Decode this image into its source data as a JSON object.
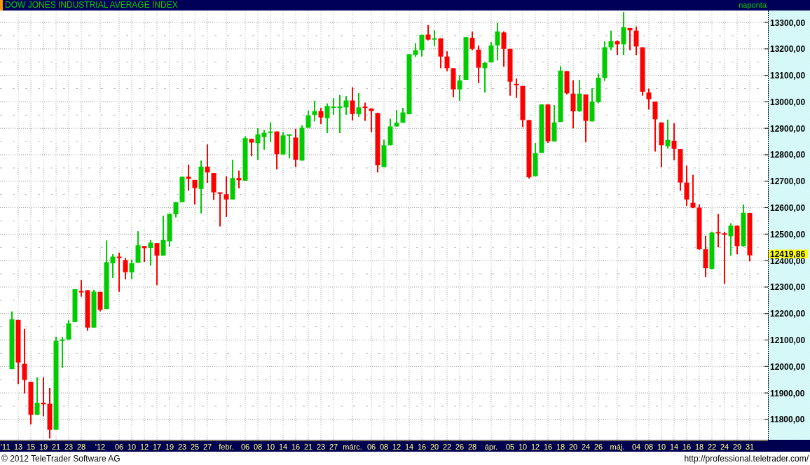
{
  "header": {
    "title": "DOW JONES INDUSTRIAL AVERAGE INDEX",
    "interval": "naponta"
  },
  "chart": {
    "start_year": "'11",
    "last_price": "12419,86",
    "chart_data": {
      "type": "candlestick",
      "grid": true,
      "ylim": [
        11723,
        13345
      ],
      "categories": [
        null,
        "13",
        null,
        "15",
        null,
        "19",
        null,
        "21",
        null,
        "23",
        null,
        "28",
        null,
        null,
        "'12",
        null,
        null,
        "06",
        null,
        "10",
        null,
        "12",
        null,
        "17",
        null,
        "19",
        null,
        "23",
        null,
        "25",
        null,
        "27",
        null,
        null,
        "febr.",
        null,
        null,
        "06",
        null,
        "08",
        null,
        "10",
        null,
        "14",
        null,
        "16",
        null,
        "21",
        null,
        "23",
        null,
        "27",
        null,
        null,
        "márc.",
        null,
        null,
        "06",
        null,
        "08",
        null,
        "12",
        null,
        "14",
        null,
        "16",
        null,
        "20",
        null,
        "22",
        null,
        "26",
        null,
        "28",
        null,
        null,
        "ápr.",
        null,
        null,
        "05",
        null,
        "10",
        null,
        "12",
        null,
        "16",
        null,
        "18",
        null,
        "20",
        null,
        "24",
        null,
        "26",
        null,
        null,
        "máj.",
        null,
        null,
        "04",
        null,
        "08",
        null,
        "10",
        null,
        "14",
        null,
        "16",
        null,
        "18",
        null,
        "22",
        null,
        "24",
        null,
        "29",
        null,
        "31"
      ],
      "ohlc": [
        [
          11990,
          12208,
          11990,
          12178
        ],
        [
          12176,
          12176,
          11934,
          12015
        ],
        [
          12010,
          12142,
          11898,
          11949
        ],
        [
          11942,
          11942,
          11781,
          11817
        ],
        [
          11817,
          11959,
          11817,
          11863
        ],
        [
          11863,
          11959,
          11812,
          11857
        ],
        [
          11859,
          11919,
          11728,
          11761
        ],
        [
          11761,
          12112,
          11761,
          12097
        ],
        [
          12097,
          12112,
          11995,
          12102
        ],
        [
          12102,
          12175,
          12102,
          12163
        ],
        [
          12168,
          12292,
          12168,
          12292
        ],
        [
          12285,
          12326,
          12264,
          12280
        ],
        [
          12288,
          12288,
          12135,
          12147
        ],
        [
          12147,
          12290,
          12147,
          12283
        ],
        [
          12282,
          12282,
          12208,
          12214
        ],
        [
          12217,
          12476,
          12217,
          12394
        ],
        [
          12390,
          12425,
          12334,
          12415
        ],
        [
          12415,
          12430,
          12282,
          12410
        ],
        [
          12402,
          12410,
          12329,
          12356
        ],
        [
          12356,
          12404,
          12331,
          12390
        ],
        [
          12392,
          12511,
          12392,
          12458
        ],
        [
          12455,
          12455,
          12395,
          12447
        ],
        [
          12448,
          12478,
          12381,
          12468
        ],
        [
          12466,
          12466,
          12307,
          12419
        ],
        [
          12419,
          12570,
          12419,
          12478
        ],
        [
          12473,
          12577,
          12453,
          12577
        ],
        [
          12575,
          12621,
          12563,
          12621
        ],
        [
          12621,
          12717,
          12621,
          12717
        ],
        [
          12717,
          12763,
          12664,
          12709
        ],
        [
          12705,
          12705,
          12612,
          12674
        ],
        [
          12671,
          12778,
          12578,
          12755
        ],
        [
          12755,
          12839,
          12694,
          12733
        ],
        [
          12731,
          12731,
          12629,
          12658
        ],
        [
          12658,
          12658,
          12529,
          12654
        ],
        [
          12651,
          12719,
          12565,
          12631
        ],
        [
          12631,
          12781,
          12631,
          12712
        ],
        [
          12712,
          12740,
          12673,
          12704
        ],
        [
          12702,
          12870,
          12702,
          12863
        ],
        [
          12860,
          12860,
          12794,
          12846
        ],
        [
          12844,
          12900,
          12781,
          12877
        ],
        [
          12867,
          12893,
          12819,
          12883
        ],
        [
          12885,
          12923,
          12848,
          12888
        ],
        [
          12888,
          12888,
          12745,
          12802
        ],
        [
          12801,
          12885,
          12801,
          12873
        ],
        [
          12872,
          12877,
          12786,
          12877
        ],
        [
          12865,
          12898,
          12753,
          12781
        ],
        [
          12778,
          12911,
          12778,
          12902
        ],
        [
          12902,
          12967,
          12902,
          12949
        ],
        [
          12951,
          13004,
          12926,
          12965
        ],
        [
          12965,
          12977,
          12916,
          12941
        ],
        [
          12938,
          12994,
          12882,
          12984
        ],
        [
          12979,
          13014,
          12951,
          12982
        ],
        [
          12979,
          13026,
          12882,
          12982
        ],
        [
          12979,
          13022,
          12951,
          13005
        ],
        [
          13005,
          13055,
          12929,
          12954
        ],
        [
          12953,
          13033,
          12943,
          12979
        ],
        [
          12982,
          12997,
          12928,
          12979
        ],
        [
          12975,
          12975,
          12885,
          12965
        ],
        [
          12958,
          12958,
          12733,
          12760
        ],
        [
          12753,
          12857,
          12753,
          12836
        ],
        [
          12836,
          12936,
          12836,
          12907
        ],
        [
          12907,
          12969,
          12905,
          12921
        ],
        [
          12921,
          12977,
          12921,
          12960
        ],
        [
          12953,
          13180,
          12953,
          13180
        ],
        [
          13177,
          13221,
          13170,
          13195
        ],
        [
          13195,
          13253,
          13171,
          13253
        ],
        [
          13254,
          13290,
          13232,
          13235
        ],
        [
          13235,
          13270,
          13211,
          13240
        ],
        [
          13240,
          13240,
          13127,
          13171
        ],
        [
          13171,
          13191,
          13116,
          13127
        ],
        [
          13127,
          13127,
          13017,
          13047
        ],
        [
          13047,
          13101,
          13004,
          13081
        ],
        [
          13083,
          13244,
          13083,
          13244
        ],
        [
          13242,
          13266,
          13195,
          13200
        ],
        [
          13197,
          13213,
          13070,
          13129
        ],
        [
          13127,
          13151,
          13035,
          13147
        ],
        [
          13149,
          13226,
          13149,
          13213
        ],
        [
          13213,
          13297,
          13156,
          13266
        ],
        [
          13262,
          13266,
          13132,
          13200
        ],
        [
          13200,
          13200,
          13023,
          13076
        ],
        [
          13068,
          13088,
          13015,
          13064
        ],
        [
          13060,
          13060,
          12904,
          12931
        ],
        [
          12931,
          12931,
          12710,
          12715
        ],
        [
          12719,
          12845,
          12719,
          12806
        ],
        [
          12807,
          12990,
          12807,
          12990
        ],
        [
          12990,
          12990,
          12845,
          12851
        ],
        [
          12851,
          12988,
          12849,
          12922
        ],
        [
          12924,
          13134,
          12924,
          13118
        ],
        [
          13116,
          13116,
          13028,
          13032
        ],
        [
          13031,
          13081,
          12900,
          12964
        ],
        [
          12964,
          13083,
          12962,
          13031
        ],
        [
          13028,
          13028,
          12847,
          12928
        ],
        [
          12926,
          13052,
          12926,
          13001
        ],
        [
          12999,
          13107,
          12994,
          13091
        ],
        [
          13091,
          13228,
          13079,
          13206
        ],
        [
          13206,
          13269,
          13195,
          13229
        ],
        [
          13229,
          13232,
          13176,
          13217
        ],
        [
          13217,
          13339,
          13176,
          13282
        ],
        [
          13279,
          13279,
          13195,
          13270
        ],
        [
          13269,
          13284,
          13176,
          13209
        ],
        [
          13206,
          13206,
          13023,
          13038
        ],
        [
          13035,
          13050,
          12971,
          13010
        ],
        [
          13001,
          13001,
          12812,
          12934
        ],
        [
          12922,
          12922,
          12752,
          12836
        ],
        [
          12832,
          12933,
          12823,
          12856
        ],
        [
          12853,
          12919,
          12779,
          12822
        ],
        [
          12821,
          12821,
          12664,
          12695
        ],
        [
          12695,
          12759,
          12607,
          12631
        ],
        [
          12618,
          12724,
          12598,
          12600
        ],
        [
          12600,
          12612,
          12441,
          12443
        ],
        [
          12443,
          12494,
          12338,
          12371
        ],
        [
          12369,
          12509,
          12367,
          12506
        ],
        [
          12508,
          12576,
          12450,
          12503
        ],
        [
          12503,
          12509,
          12312,
          12499
        ],
        [
          12492,
          12541,
          12419,
          12532
        ],
        [
          12532,
          12532,
          12424,
          12455
        ],
        [
          12455,
          12612,
          12452,
          12581
        ],
        [
          12580,
          12580,
          12397,
          12420
        ]
      ],
      "yticks": [
        {
          "value": 13300,
          "label": "13300,00"
        },
        {
          "value": 13200,
          "label": "13200,00"
        },
        {
          "value": 13100,
          "label": "13100,00"
        },
        {
          "value": 13000,
          "label": "13000,00"
        },
        {
          "value": 12900,
          "label": "12900,00"
        },
        {
          "value": 12800,
          "label": "12800,00"
        },
        {
          "value": 12700,
          "label": "12700,00"
        },
        {
          "value": 12600,
          "label": "12600,00"
        },
        {
          "value": 12500,
          "label": "12500,00"
        },
        {
          "value": 12400,
          "label": "12400,00"
        },
        {
          "value": 12300,
          "label": "12300,00"
        },
        {
          "value": 12200,
          "label": "12200,00"
        },
        {
          "value": 12100,
          "label": "12100,00"
        },
        {
          "value": 12000,
          "label": "12000,00"
        },
        {
          "value": 11900,
          "label": "11900,00"
        },
        {
          "value": 11800,
          "label": "11800,00"
        }
      ]
    }
  },
  "footer": {
    "copyright": "© 2012 TeleTrader Software AG",
    "url": "http://professional.teletrader.com/"
  }
}
